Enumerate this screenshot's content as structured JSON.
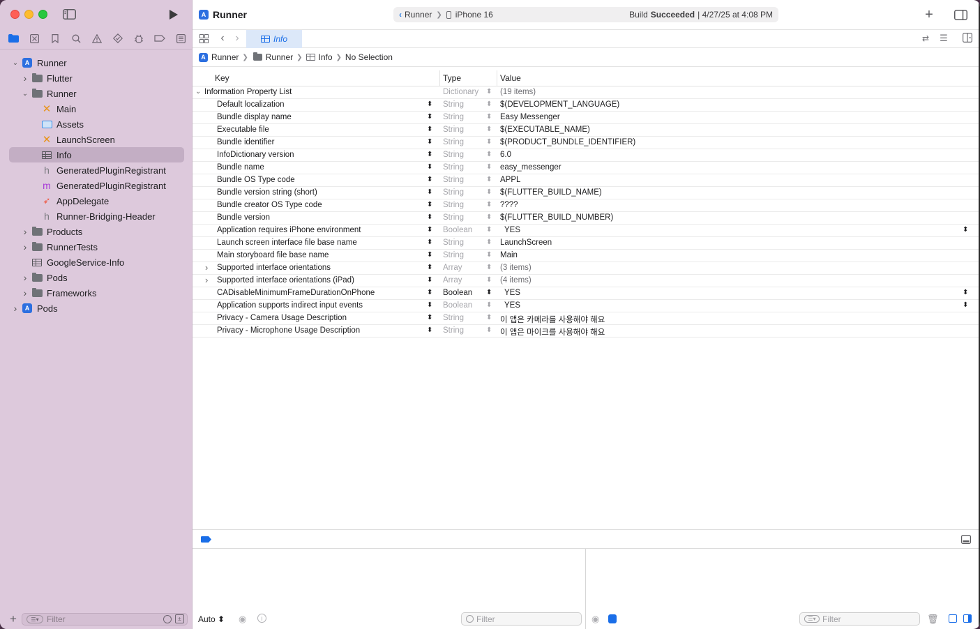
{
  "toolbar": {
    "title": "Runner",
    "scheme": "Runner",
    "device": "iPhone 16",
    "status_prefix": "Build",
    "status_bold": "Succeeded",
    "status_time": "| 4/27/25 at 4:08 PM"
  },
  "editor_tab": {
    "label": "Info"
  },
  "breadcrumb": [
    "Runner",
    "Runner",
    "Info",
    "No Selection"
  ],
  "navigator": {
    "items": [
      {
        "label": "Runner",
        "level": 0,
        "icon": "project-icon",
        "disclosure": "open"
      },
      {
        "label": "Flutter",
        "level": 1,
        "icon": "folder-icon",
        "disclosure": "closed"
      },
      {
        "label": "Runner",
        "level": 1,
        "icon": "folder-icon",
        "disclosure": "open"
      },
      {
        "label": "Main",
        "level": 2,
        "icon": "storyboard-icon",
        "disclosure": "none"
      },
      {
        "label": "Assets",
        "level": 2,
        "icon": "asset-catalog-icon",
        "disclosure": "none"
      },
      {
        "label": "LaunchScreen",
        "level": 2,
        "icon": "storyboard-icon",
        "disclosure": "none"
      },
      {
        "label": "Info",
        "level": 2,
        "icon": "plist-icon",
        "disclosure": "none",
        "selected": true
      },
      {
        "label": "GeneratedPluginRegistrant",
        "level": 2,
        "icon": "header-file-icon",
        "disclosure": "none"
      },
      {
        "label": "GeneratedPluginRegistrant",
        "level": 2,
        "icon": "objc-file-icon",
        "disclosure": "none"
      },
      {
        "label": "AppDelegate",
        "level": 2,
        "icon": "swift-file-icon",
        "disclosure": "none"
      },
      {
        "label": "Runner-Bridging-Header",
        "level": 2,
        "icon": "header-file-icon",
        "disclosure": "none"
      },
      {
        "label": "Products",
        "level": 1,
        "icon": "folder-icon",
        "disclosure": "closed"
      },
      {
        "label": "RunnerTests",
        "level": 1,
        "icon": "folder-icon",
        "disclosure": "closed"
      },
      {
        "label": "GoogleService-Info",
        "level": 1,
        "icon": "plist-icon",
        "disclosure": "none"
      },
      {
        "label": "Pods",
        "level": 1,
        "icon": "folder-icon",
        "disclosure": "closed"
      },
      {
        "label": "Frameworks",
        "level": 1,
        "icon": "folder-icon",
        "disclosure": "closed"
      },
      {
        "label": "Pods",
        "level": 0,
        "icon": "project-icon",
        "disclosure": "closed"
      }
    ],
    "filter_placeholder": "Filter"
  },
  "plist": {
    "headers": {
      "key": "Key",
      "type": "Type",
      "value": "Value"
    },
    "root": {
      "key": "Information Property List",
      "type": "Dictionary",
      "value": "(19 items)"
    },
    "rows": [
      {
        "key": "Default localization",
        "type": "String",
        "value": "$(DEVELOPMENT_LANGUAGE)"
      },
      {
        "key": "Bundle display name",
        "type": "String",
        "value": "Easy Messenger"
      },
      {
        "key": "Executable file",
        "type": "String",
        "value": "$(EXECUTABLE_NAME)"
      },
      {
        "key": "Bundle identifier",
        "type": "String",
        "value": "$(PRODUCT_BUNDLE_IDENTIFIER)"
      },
      {
        "key": "InfoDictionary version",
        "type": "String",
        "value": "6.0"
      },
      {
        "key": "Bundle name",
        "type": "String",
        "value": "easy_messenger"
      },
      {
        "key": "Bundle OS Type code",
        "type": "String",
        "value": "APPL"
      },
      {
        "key": "Bundle version string (short)",
        "type": "String",
        "value": "$(FLUTTER_BUILD_NAME)"
      },
      {
        "key": "Bundle creator OS Type code",
        "type": "String",
        "value": "????"
      },
      {
        "key": "Bundle version",
        "type": "String",
        "value": "$(FLUTTER_BUILD_NUMBER)"
      },
      {
        "key": "Application requires iPhone environment",
        "type": "Boolean",
        "value": "YES",
        "bool": true
      },
      {
        "key": "Launch screen interface file base name",
        "type": "String",
        "value": "LaunchScreen"
      },
      {
        "key": "Main storyboard file base name",
        "type": "String",
        "value": "Main"
      },
      {
        "key": "Supported interface orientations",
        "type": "Array",
        "value": "(3 items)",
        "expandable": true
      },
      {
        "key": "Supported interface orientations (iPad)",
        "type": "Array",
        "value": "(4 items)",
        "expandable": true
      },
      {
        "key": "CADisableMinimumFrameDurationOnPhone",
        "type": "Boolean",
        "value": "YES",
        "bool": true,
        "typeDark": true
      },
      {
        "key": "Application supports indirect input events",
        "type": "Boolean",
        "value": "YES",
        "bool": true
      },
      {
        "key": "Privacy - Camera Usage Description",
        "type": "String",
        "value": "이 앱은 카메라를 사용해야 해요"
      },
      {
        "key": "Privacy - Microphone Usage Description",
        "type": "String",
        "value": "이 앱은 마이크를 사용해야 해요"
      }
    ]
  },
  "debug": {
    "auto_label": "Auto",
    "filter_left": "Filter",
    "filter_right": "Filter"
  },
  "colors": {
    "sidebar_bg": "#ddc9dc",
    "accent": "#1a6ee8",
    "selection": "#c3aec4"
  }
}
